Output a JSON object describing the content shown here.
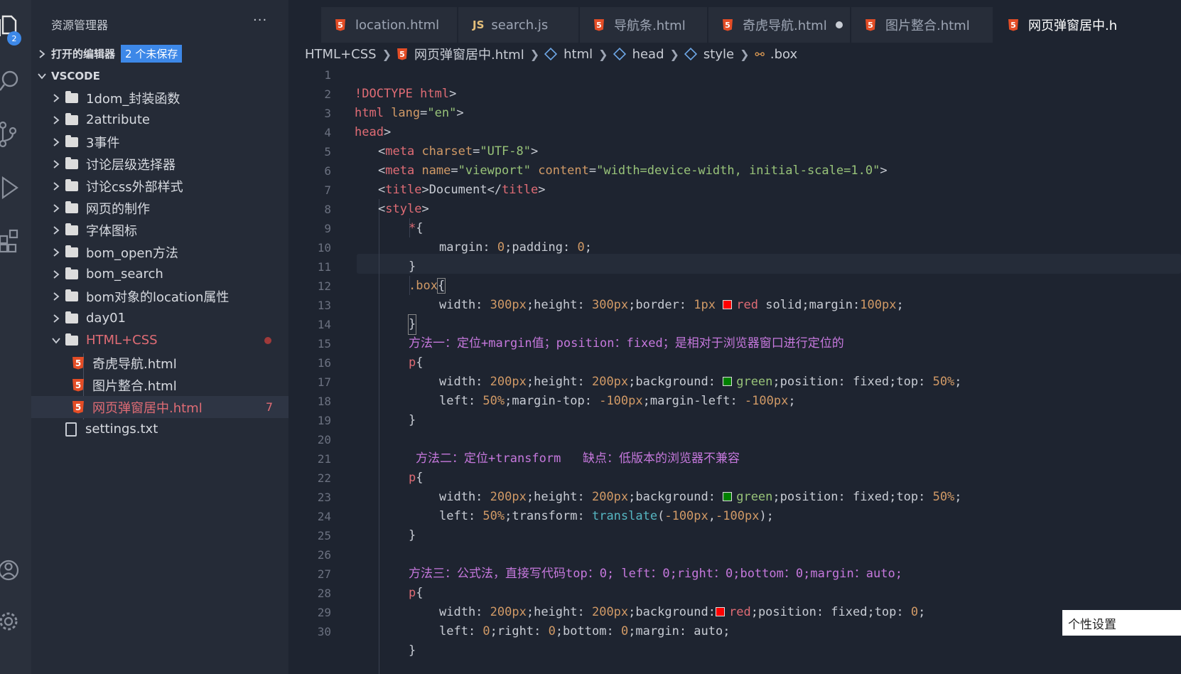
{
  "activity": {
    "explorer_badge": "2"
  },
  "sidebar": {
    "title": "资源管理器",
    "more": "···",
    "open_editors": {
      "label": "打开的编辑器",
      "unsaved": "2 个未保存"
    },
    "workspace": "VSCODE",
    "items": [
      {
        "label": "1dom_封装函数"
      },
      {
        "label": "2attribute"
      },
      {
        "label": "3事件"
      },
      {
        "label": "讨论层级选择器"
      },
      {
        "label": "讨论css外部样式"
      },
      {
        "label": "网页的制作"
      },
      {
        "label": "字体图标"
      },
      {
        "label": "bom_open方法"
      },
      {
        "label": "bom_search"
      },
      {
        "label": "bom对象的location属性"
      },
      {
        "label": "day01"
      },
      {
        "label": "HTML+CSS"
      }
    ],
    "children": [
      {
        "label": "奇虎导航.html"
      },
      {
        "label": "图片整合.html"
      },
      {
        "label": "网页弹窗居中.html",
        "count": "7"
      }
    ],
    "settings": "settings.txt"
  },
  "tabs": [
    {
      "label": "location.html",
      "icon": "html5-icon"
    },
    {
      "label": "search.js",
      "icon": "js-icon",
      "prefix": "JS"
    },
    {
      "label": "导航条.html",
      "icon": "html5-icon"
    },
    {
      "label": "奇虎导航.html",
      "icon": "html5-icon"
    },
    {
      "label": "图片整合.html",
      "icon": "html5-icon"
    },
    {
      "label": "网页弹窗居中.h",
      "icon": "html5-icon"
    }
  ],
  "breadcrumb": {
    "folder": "HTML+CSS",
    "file": "网页弹窗居中.html",
    "html": "html",
    "head": "head",
    "style": "style",
    "selector": ".box"
  },
  "editor": {
    "line_numbers": [
      "1",
      "2",
      "3",
      "4",
      "5",
      "6",
      "7",
      "8",
      "9",
      "10",
      "11",
      "12",
      "13",
      "14",
      "15",
      "16",
      "17",
      "18",
      "19",
      "20",
      "21",
      "22",
      "23",
      "24",
      "25",
      "26",
      "27",
      "28",
      "29",
      "30"
    ],
    "l1": [
      "!DOCTYPE",
      " html",
      ">"
    ],
    "l2": [
      "html",
      " lang",
      "=",
      "\"en\"",
      ">"
    ],
    "l3": [
      "head",
      ">"
    ],
    "l4": [
      "<",
      "meta",
      " charset",
      "=",
      "\"UTF-8\"",
      ">"
    ],
    "l5": [
      "<",
      "meta",
      " name",
      "=",
      "\"viewport\"",
      " content",
      "=",
      "\"width=device-width, initial-scale=1.0\"",
      ">"
    ],
    "l6": [
      "<",
      "title",
      ">",
      "Document",
      "</",
      "title",
      ">"
    ],
    "l7": [
      "<",
      "style",
      ">"
    ],
    "l8": [
      "*",
      "{"
    ],
    "l9": [
      "margin: ",
      "0",
      ";padding: ",
      "0",
      ";"
    ],
    "l10": "}",
    "l11": [
      ".box",
      "{"
    ],
    "l12": [
      "width: ",
      "300px",
      ";height: ",
      "300px",
      ";border: ",
      "1px",
      "red",
      " solid;margin:",
      "100px",
      ";"
    ],
    "l13": "}",
    "l14": [
      "方法一：定位+margin值；position：fixed；是相对于浏览器窗口进行定位的"
    ],
    "l15": [
      "p",
      "{"
    ],
    "l16": [
      "width: ",
      "200px",
      ";height: ",
      "200px",
      ";background: ",
      "green",
      ";position: fixed;top: ",
      "50%",
      ";"
    ],
    "l17": [
      "left: ",
      "50%",
      ";margin-top: ",
      "-100px",
      ";margin-left: ",
      "-100px",
      ";"
    ],
    "l18": "}",
    "l20": [
      "方法二：定位+transform   缺点：低版本的浏览器不兼容"
    ],
    "l21": [
      "p",
      "{"
    ],
    "l22": [
      "width: ",
      "200px",
      ";height: ",
      "200px",
      ";background: ",
      "green",
      ";position: fixed;top: ",
      "50%",
      ";"
    ],
    "l23": [
      "left: ",
      "50%",
      ";transform: ",
      "translate",
      "(",
      "-100px",
      ",",
      "-100px",
      ");"
    ],
    "l24": "}",
    "l26": [
      "方法三：公式法，直接写代码top：0; left：0;right：0;bottom：0;margin：auto;"
    ],
    "l27": [
      "p",
      "{"
    ],
    "l28": [
      "width: ",
      "200px",
      ";height: ",
      "200px",
      ";background:",
      "red",
      ";position: fixed;top: ",
      "0",
      ";"
    ],
    "l29": [
      "left: ",
      "0",
      ";right: ",
      "0",
      ";bottom: ",
      "0",
      ";margin: auto;"
    ],
    "l30": "}"
  },
  "colors": {
    "red_swatch": "#ff0000",
    "green_swatch": "#008000"
  },
  "tooltip": "个性设置"
}
